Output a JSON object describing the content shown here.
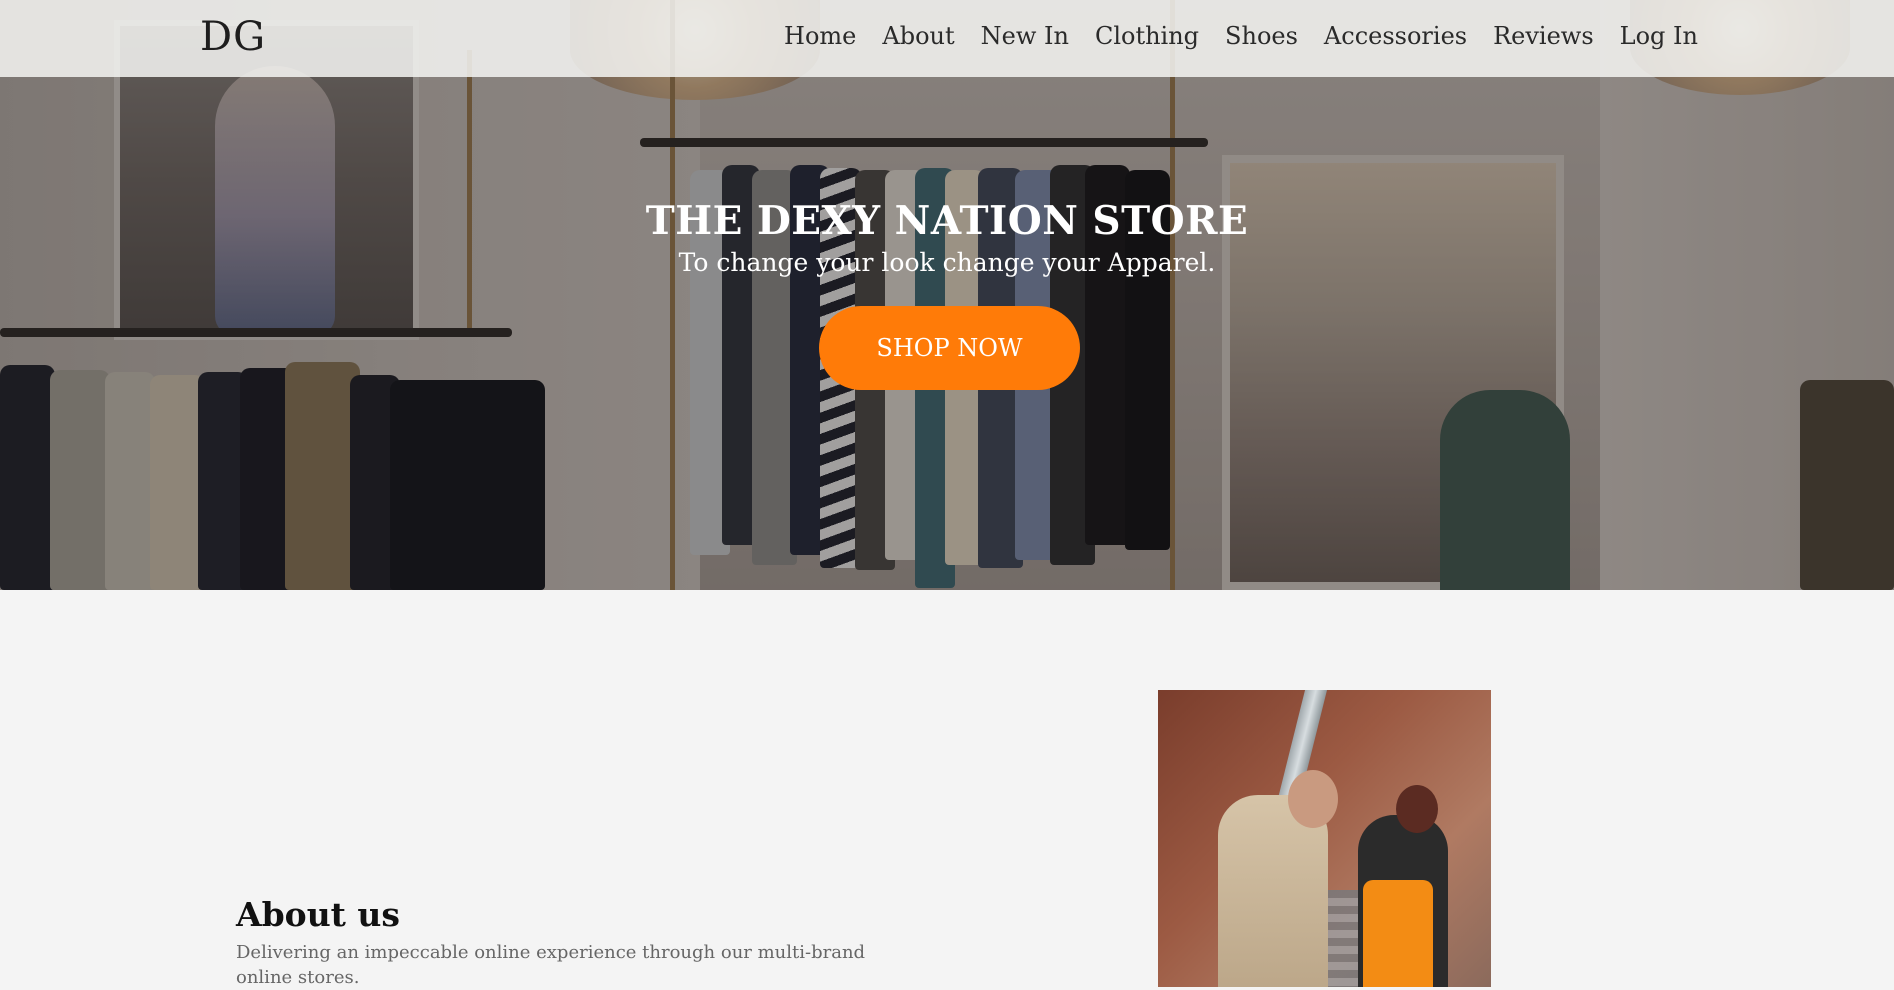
{
  "nav": {
    "logo": "DG",
    "links": [
      "Home",
      "About",
      "New In",
      "Clothing",
      "Shoes",
      "Accessories",
      "Reviews",
      "Log In"
    ]
  },
  "hero": {
    "title": "THE DEXY NATION STORE",
    "subtitle": "To change your look change your Apparel.",
    "cta_label": "SHOP NOW"
  },
  "about": {
    "heading": "About us",
    "text": "Delivering an impeccable online experience through our multi-brand online stores."
  },
  "colors": {
    "accent": "#ff7b08",
    "background": "#f4f4f4",
    "navbar": "#f5f4f2"
  }
}
